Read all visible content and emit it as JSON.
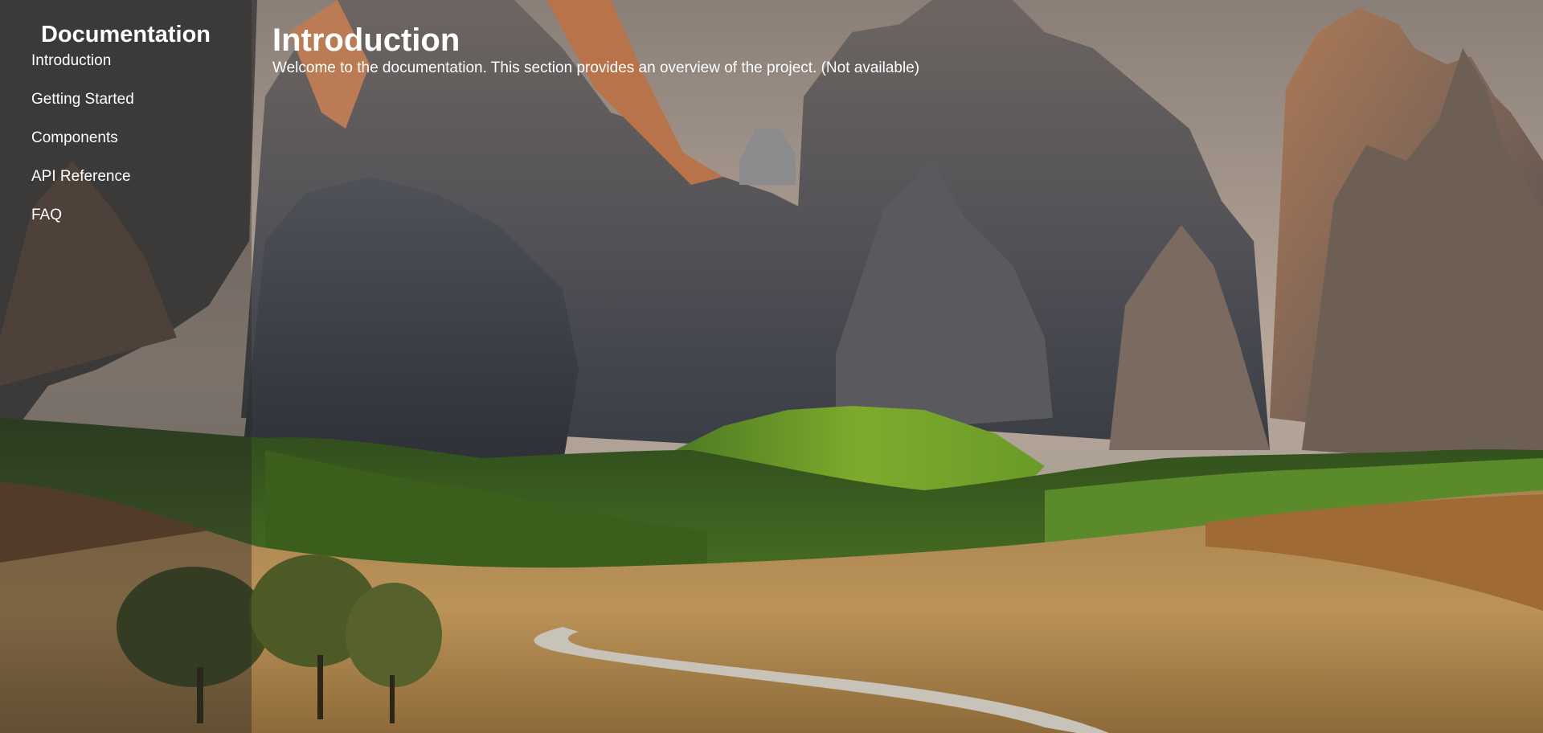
{
  "sidebar": {
    "title": "Documentation",
    "items": [
      {
        "label": "Introduction"
      },
      {
        "label": "Getting Started"
      },
      {
        "label": "Components"
      },
      {
        "label": "API Reference"
      },
      {
        "label": "FAQ"
      }
    ]
  },
  "main": {
    "title": "Introduction",
    "text": "Welcome to the documentation. This section provides an overview of the project. (Not available)"
  },
  "colors": {
    "sidebar_overlay": "#282828",
    "text": "#ffffff"
  }
}
